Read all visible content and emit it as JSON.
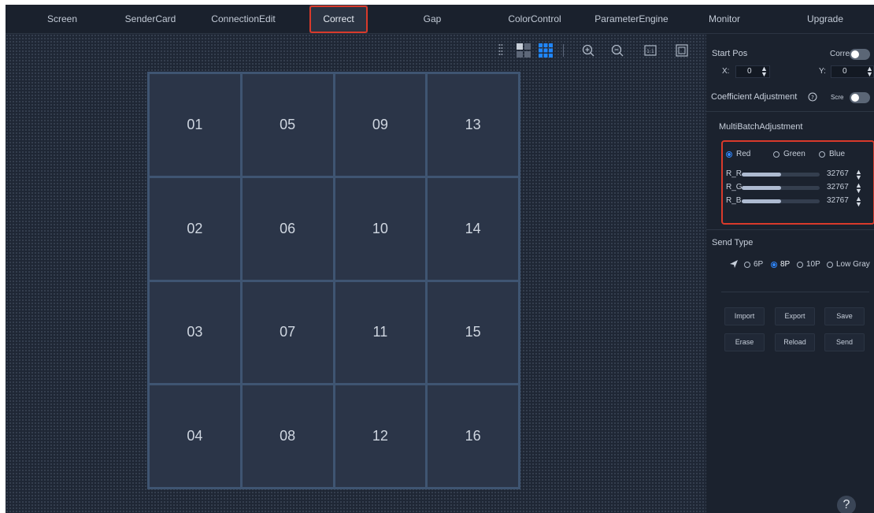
{
  "nav": {
    "tabs": [
      {
        "label": "Screen"
      },
      {
        "label": "SenderCard"
      },
      {
        "label": "ConnectionEdit"
      },
      {
        "label": "Correct"
      },
      {
        "label": "Gap"
      },
      {
        "label": "ColorControl"
      },
      {
        "label": "ParameterEngine"
      },
      {
        "label": "Monitor"
      },
      {
        "label": "Upgrade"
      }
    ],
    "active_tab": "Correct"
  },
  "toolbar": {
    "icons": [
      "grid-view-2x2-icon",
      "grid-view-4x4-icon",
      "zoom-in-icon",
      "zoom-out-icon",
      "actual-size-icon",
      "fit-screen-icon"
    ]
  },
  "canvas": {
    "cells": [
      "01",
      "05",
      "09",
      "13",
      "02",
      "06",
      "10",
      "14",
      "03",
      "07",
      "11",
      "15",
      "04",
      "08",
      "12",
      "16"
    ]
  },
  "panel": {
    "start_pos": {
      "label": "Start Pos",
      "correct_label": "Correct",
      "x_label": "X:",
      "x_value": "0",
      "y_label": "Y:",
      "y_value": "0"
    },
    "coefficient": {
      "label": "Coefficient Adjustment",
      "toggle_label": "Scre"
    },
    "multibatch": {
      "title": "MultiBatchAdjustment",
      "colors": [
        "Red",
        "Green",
        "Blue"
      ],
      "selected": "Red",
      "sliders": [
        {
          "label": "R_R",
          "value": "32767",
          "fraction": 0.5
        },
        {
          "label": "R_G",
          "value": "32767",
          "fraction": 0.5
        },
        {
          "label": "R_B",
          "value": "32767",
          "fraction": 0.5
        }
      ]
    },
    "send_type": {
      "title": "Send Type",
      "options": [
        "6P",
        "8P",
        "10P",
        "Low Gray"
      ],
      "selected": "8P"
    },
    "buttons": {
      "import": "Import",
      "export": "Export",
      "save": "Save",
      "erase": "Erase",
      "reload": "Reload",
      "send": "Send"
    },
    "help": "?"
  },
  "colors": {
    "accent": "#2f86ff",
    "highlight": "#d93a2b",
    "background": "#1c2330"
  }
}
